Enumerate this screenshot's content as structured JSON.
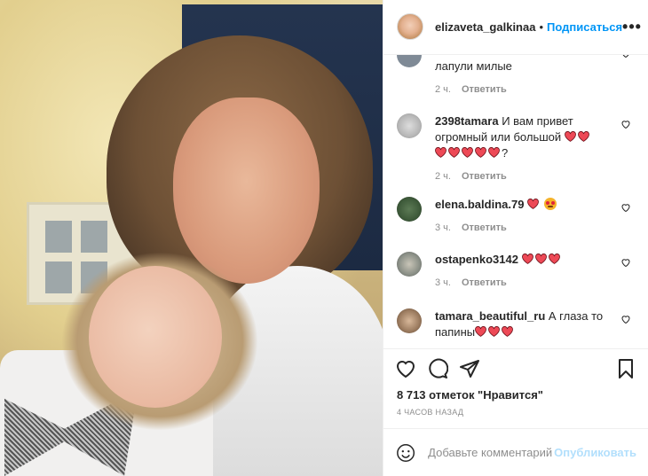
{
  "header": {
    "username": "elizaveta_galkinaa",
    "separator": "•",
    "follow_label": "Подписаться",
    "more_label": "•••"
  },
  "comments": [
    {
      "username": "",
      "text": "лапули милые",
      "time": "2 ч.",
      "reply": "Ответить",
      "hearts": 0,
      "avatar_color": "#7f8a96"
    },
    {
      "username": "2398tamara",
      "text": "И вам привет огромный или большой",
      "after_hearts_text": "?",
      "time": "2 ч.",
      "reply": "Ответить",
      "hearts": 7,
      "avatar_color": "#b7b7b7"
    },
    {
      "username": "elena.baldina.79",
      "text": "",
      "time": "3 ч.",
      "reply": "Ответить",
      "hearts": 1,
      "avatar_color": "#3e5a3a"
    },
    {
      "username": "ostapenko3142",
      "text": "",
      "time": "3 ч.",
      "reply": "Ответить",
      "hearts": 3,
      "avatar_color": "#8a8f86"
    },
    {
      "username": "tamara_beautiful_ru",
      "text": "А глаза то папины",
      "time": "",
      "reply": "",
      "hearts": 3,
      "avatar_color": "#9a7a5e"
    }
  ],
  "likes_text": "8 713 отметок \"Нравится\"",
  "post_time": "4 часов назад",
  "comment_box": {
    "placeholder": "Добавьте комментарий...",
    "post_label": "Опубликовать"
  },
  "colors": {
    "accent": "#0095f6",
    "heart": "#ed4956"
  }
}
